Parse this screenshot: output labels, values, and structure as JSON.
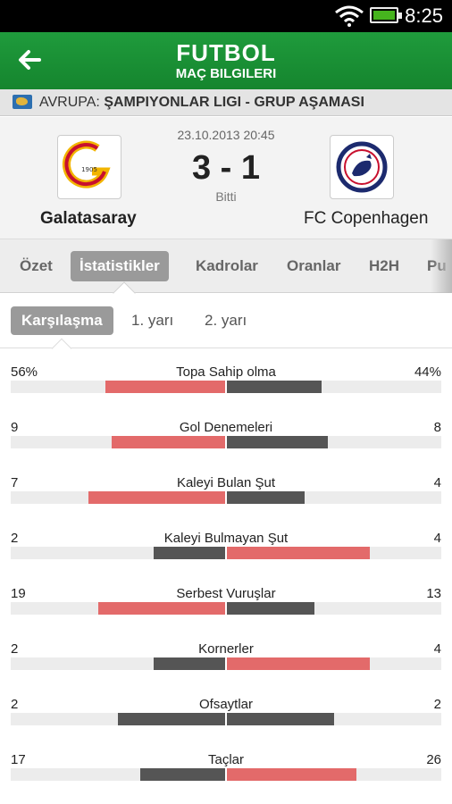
{
  "status_bar": {
    "time": "8:25"
  },
  "header": {
    "title": "FUTBOL",
    "subtitle": "MAÇ BILGILERI",
    "back_icon": "back-arrow-icon"
  },
  "competition": {
    "region": "AVRUPA:",
    "league": "ŞAMPIYONLAR LIGI - GRUP AŞAMASI",
    "flag_icon": "europe-map-icon"
  },
  "match": {
    "datetime": "23.10.2013 20:45",
    "score": "3 - 1",
    "status": "Bitti",
    "home_team": "Galatasaray",
    "away_team": "FC Copenhagen",
    "home_logo_text": "1905"
  },
  "tabs": [
    "Özet",
    "İstatistikler",
    "Kadrolar",
    "Oranlar",
    "H2H",
    "Pu"
  ],
  "active_tab": "İstatistikler",
  "subtabs": [
    "Karşılaşma",
    "1. yarı",
    "2. yarı"
  ],
  "active_subtab": "Karşılaşma",
  "colors": {
    "header_green": "#1a913a",
    "leader": "#e36a6a",
    "trailer": "#555555"
  },
  "stats": [
    {
      "label": "Topa Sahip olma",
      "home": "56%",
      "away": "44%",
      "home_value": 56,
      "away_value": 44
    },
    {
      "label": "Gol Denemeleri",
      "home": "9",
      "away": "8",
      "home_value": 9,
      "away_value": 8
    },
    {
      "label": "Kaleyi Bulan Şut",
      "home": "7",
      "away": "4",
      "home_value": 7,
      "away_value": 4
    },
    {
      "label": "Kaleyi Bulmayan Şut",
      "home": "2",
      "away": "4",
      "home_value": 2,
      "away_value": 4
    },
    {
      "label": "Serbest Vuruşlar",
      "home": "19",
      "away": "13",
      "home_value": 19,
      "away_value": 13
    },
    {
      "label": "Kornerler",
      "home": "2",
      "away": "4",
      "home_value": 2,
      "away_value": 4
    },
    {
      "label": "Ofsaytlar",
      "home": "2",
      "away": "2",
      "home_value": 2,
      "away_value": 2
    },
    {
      "label": "Taçlar",
      "home": "17",
      "away": "26",
      "home_value": 17,
      "away_value": 26
    }
  ]
}
